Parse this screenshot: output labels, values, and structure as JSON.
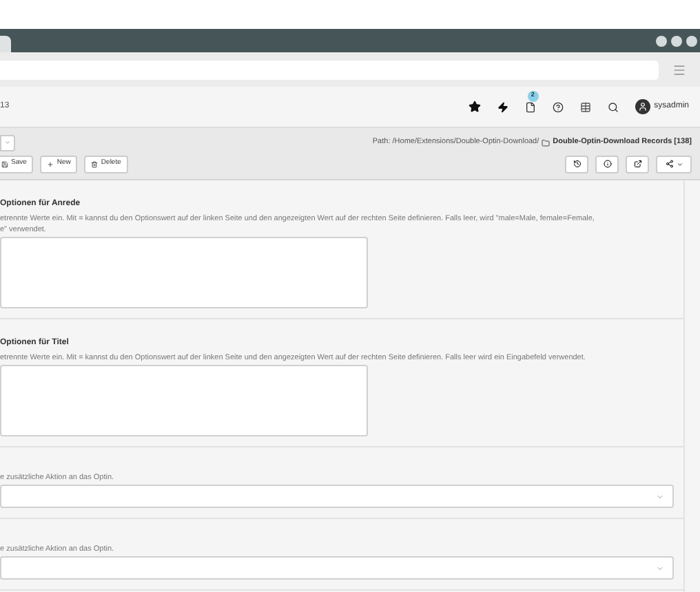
{
  "topbar": {
    "site_fragment": "13",
    "notification_count": "2",
    "user": "sysadmin"
  },
  "docheader": {
    "path_prefix": "Path: /Home/Extensions/Double-Optin-Download/",
    "path_page": "Double-Optin-Download Records [138]",
    "buttons": [
      {
        "kind": "save",
        "label": "Save"
      },
      {
        "kind": "new",
        "label": "New"
      },
      {
        "kind": "delete",
        "label": "Delete"
      }
    ]
  },
  "fields": [
    {
      "kind": "textarea",
      "label": "Optionen für Anrede",
      "description_lines": [
        "etrennte Werte ein. Mit = kannst du den Optionswert auf der linken Seite und den angezeigten Wert auf der rechten Seite definieren. Falls leer, wird \"male=Male, female=Female,",
        "e\" verwendet."
      ]
    },
    {
      "kind": "textarea",
      "label": "Optionen für Titel",
      "description_lines": [
        "etrennte Werte ein. Mit = kannst du den Optionswert auf der linken Seite und den angezeigten Wert auf der rechten Seite definieren. Falls leer wird ein Eingabefeld verwendet."
      ]
    },
    {
      "kind": "select",
      "description_lines": [
        "e zusätzliche Aktion an das Optin."
      ]
    },
    {
      "kind": "select",
      "description_lines": [
        "e zusätzliche Aktion an das Optin."
      ]
    }
  ]
}
